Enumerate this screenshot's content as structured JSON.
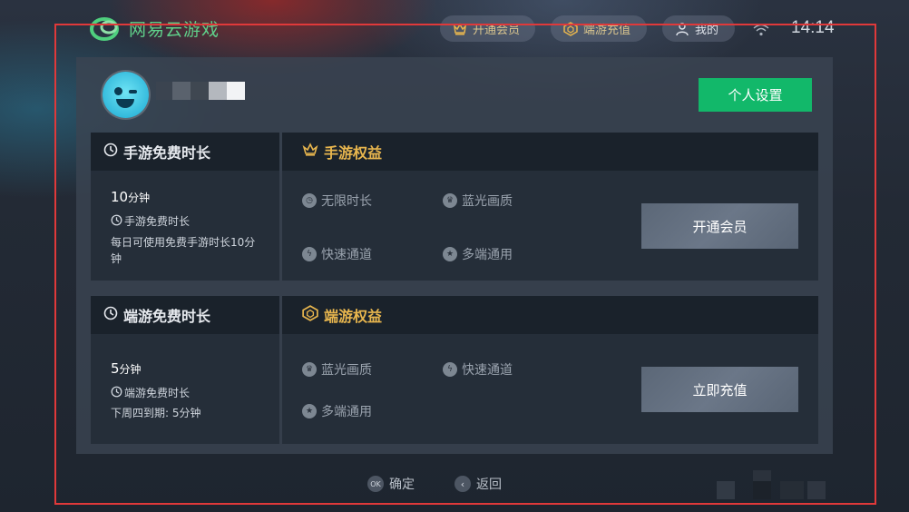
{
  "app": {
    "logo_text": "网易云游戏"
  },
  "topbar": {
    "vip_label": "开通会员",
    "recharge_label": "端游充值",
    "me_label": "我的",
    "time": "14:14"
  },
  "profile": {
    "settings_button": "个人设置"
  },
  "mobile": {
    "free_title": "手游免费时长",
    "minutes_value": "10",
    "minutes_unit": "分钟",
    "sub_label": "手游免费时长",
    "desc": "每日可使用免费手游时长10分钟",
    "benefit_title": "手游权益",
    "perks": [
      "无限时长",
      "蓝光画质",
      "快速通道",
      "多端通用"
    ],
    "action_button": "开通会员"
  },
  "pc": {
    "free_title": "端游免费时长",
    "minutes_value": "5",
    "minutes_unit": "分钟",
    "sub_label": "端游免费时长",
    "desc": "下周四到期: 5分钟",
    "benefit_title": "端游权益",
    "perks": [
      "蓝光画质",
      "快速通道",
      "多端通用"
    ],
    "action_button": "立即充值"
  },
  "footer": {
    "ok_key": "OK",
    "ok_label": "确定",
    "back_label": "返回"
  },
  "colors": {
    "accent_green": "#12b86a",
    "gold": "#e8b64e",
    "highlight_border": "#e0393a"
  }
}
